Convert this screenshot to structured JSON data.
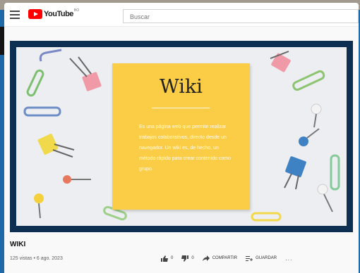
{
  "header": {
    "logo_text": "YouTube",
    "country_code": "BO",
    "search_placeholder": "Buscar"
  },
  "thumbnail": {
    "note_title": "Wiki",
    "note_text": "Es una página web que permite realizar trabajos colaborativos, directo desde un navegador. Un wiki es, de hecho, un método rápido para crear contenido como grupo."
  },
  "video": {
    "title": "WIKI",
    "meta": "125 vistas • 6 ago. 2023"
  },
  "actions": {
    "like_count": "0",
    "dislike_count": "0",
    "share_label": "COMPARTIR",
    "save_label": "GUARDAR",
    "more_label": "..."
  },
  "colors": {
    "brand": "#ff0000",
    "note": "#fbcd46",
    "frame": "#0d2f52"
  }
}
